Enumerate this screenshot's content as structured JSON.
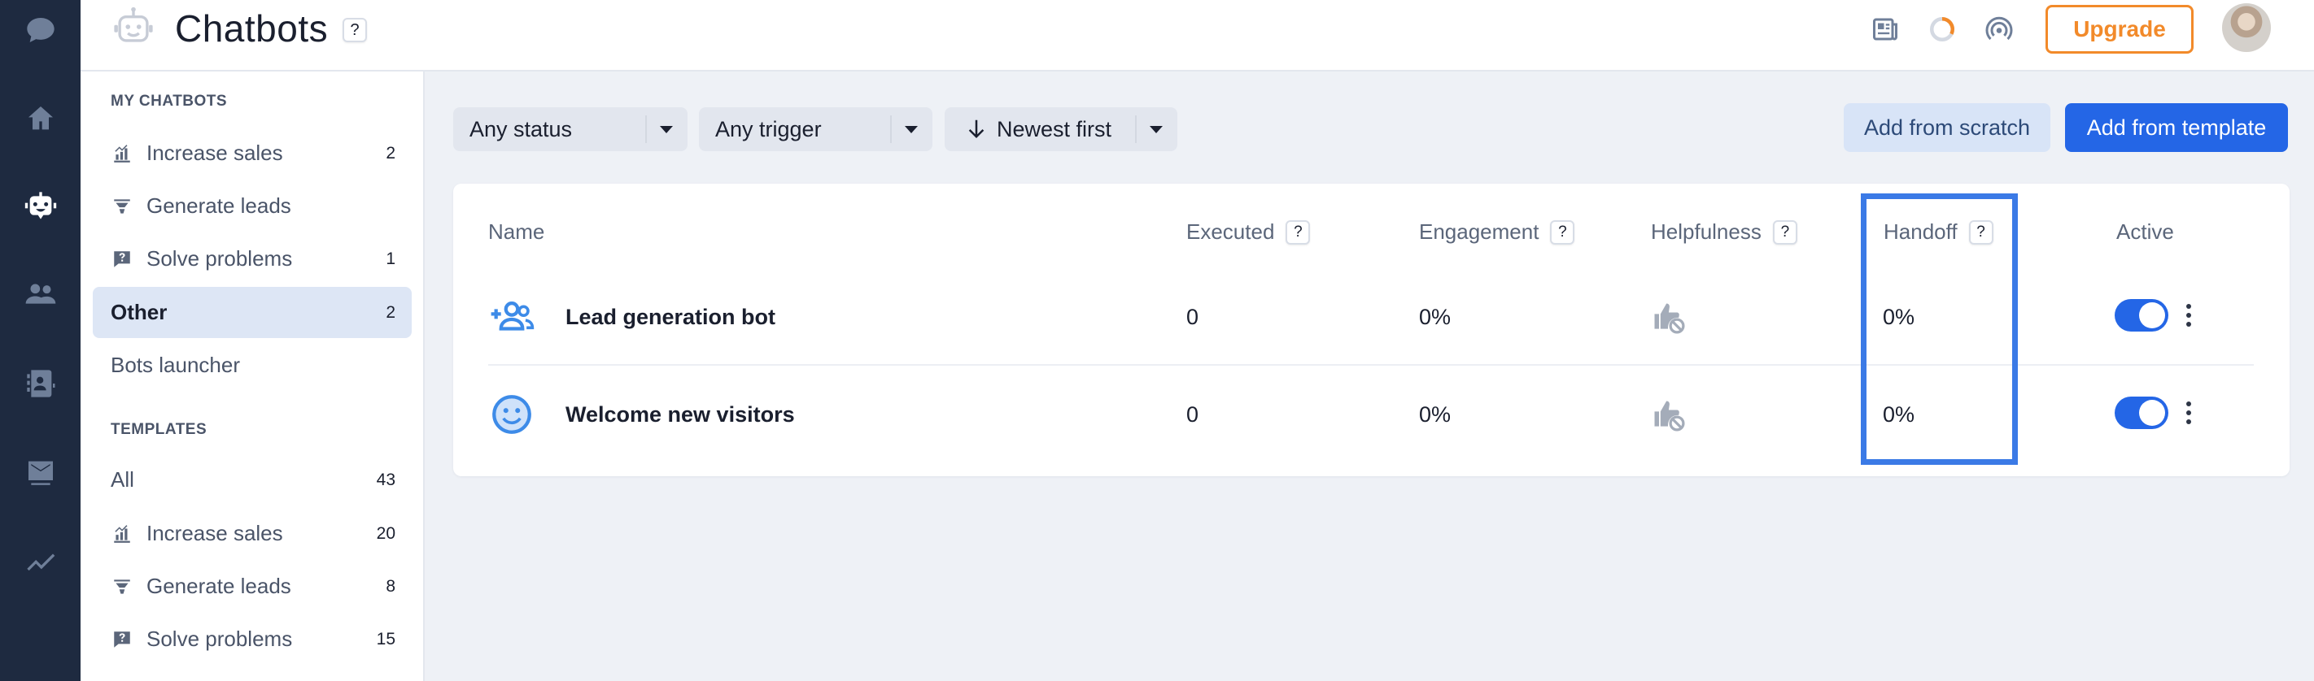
{
  "header": {
    "title": "Chatbots",
    "title_help": "?",
    "upgrade_label": "Upgrade"
  },
  "sidebar": {
    "my_chatbots_label": "MY CHATBOTS",
    "my_items": [
      {
        "label": "Increase sales",
        "count": "2"
      },
      {
        "label": "Generate leads",
        "count": ""
      },
      {
        "label": "Solve problems",
        "count": "1"
      },
      {
        "label": "Other",
        "count": "2"
      },
      {
        "label": "Bots launcher",
        "count": ""
      }
    ],
    "templates_label": "TEMPLATES",
    "template_items": [
      {
        "label": "All",
        "count": "43"
      },
      {
        "label": "Increase sales",
        "count": "20"
      },
      {
        "label": "Generate leads",
        "count": "8"
      },
      {
        "label": "Solve problems",
        "count": "15"
      }
    ]
  },
  "filters": {
    "status": "Any status",
    "trigger": "Any trigger",
    "sort": "Newest first"
  },
  "actions": {
    "scratch": "Add from scratch",
    "template": "Add from template"
  },
  "table": {
    "headers": {
      "name": "Name",
      "executed": "Executed",
      "engagement": "Engagement",
      "helpfulness": "Helpfulness",
      "handoff": "Handoff",
      "active": "Active"
    },
    "help": "?",
    "rows": [
      {
        "name": "Lead generation bot",
        "executed": "0",
        "engagement": "0%",
        "handoff": "0%",
        "active": true
      },
      {
        "name": "Welcome new visitors",
        "executed": "0",
        "engagement": "0%",
        "handoff": "0%",
        "active": true
      }
    ]
  },
  "colors": {
    "accent": "#2466e6",
    "upgrade": "#f28a2a",
    "highlight": "#3b7ae6"
  },
  "icons": {
    "rail": [
      "chat-icon",
      "home-icon",
      "bot-icon",
      "users-icon",
      "contacts-icon",
      "inbox-icon",
      "stats-icon"
    ],
    "top": [
      "news-icon",
      "progress-icon",
      "broadcast-icon"
    ]
  }
}
